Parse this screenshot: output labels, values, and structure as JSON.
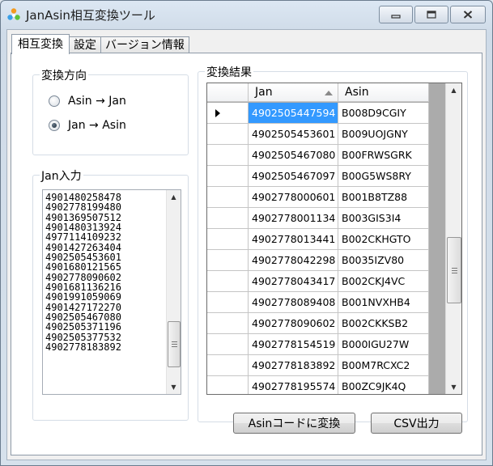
{
  "window": {
    "title": "JanAsin相互変換ツール",
    "icon": "app-recycle-icon"
  },
  "tabs": [
    {
      "label": "相互変換",
      "active": true
    },
    {
      "label": "設定",
      "active": false
    },
    {
      "label": "バージョン情報",
      "active": false
    }
  ],
  "direction": {
    "title": "変換方向",
    "options": [
      {
        "label": "Asin → Jan",
        "selected": false
      },
      {
        "label": "Jan → Asin",
        "selected": true
      }
    ]
  },
  "jan_input": {
    "title": "Jan入力",
    "lines": [
      "4901480258478",
      "4902778199480",
      "4901369507512",
      "4901480313924",
      "4977114109232",
      "4901427263404",
      "4902505453601",
      "4901680121565",
      "4902778090602",
      "4901681136216",
      "4901991059069",
      "4901427172270",
      "4902505467080",
      "4902505371196",
      "4902505377532",
      "4902778183892"
    ]
  },
  "results": {
    "title": "変換結果",
    "columns": [
      "Jan",
      "Asin"
    ],
    "rows": [
      {
        "jan": "4902505447594",
        "asin": "B008D9CGIY"
      },
      {
        "jan": "4902505453601",
        "asin": "B009UOJGNY"
      },
      {
        "jan": "4902505467080",
        "asin": "B00FRWSGRK"
      },
      {
        "jan": "4902505467097",
        "asin": "B00G5WS8RY"
      },
      {
        "jan": "4902778000601",
        "asin": "B001B8TZ88"
      },
      {
        "jan": "4902778001134",
        "asin": "B003GIS3I4"
      },
      {
        "jan": "4902778013441",
        "asin": "B002CKHGTO"
      },
      {
        "jan": "4902778042298",
        "asin": "B0035IZV80"
      },
      {
        "jan": "4902778043417",
        "asin": "B002CKJ4VC"
      },
      {
        "jan": "4902778089408",
        "asin": "B001NVXHB4"
      },
      {
        "jan": "4902778090602",
        "asin": "B002CKKSB2"
      },
      {
        "jan": "4902778154519",
        "asin": "B000IGU27W"
      },
      {
        "jan": "4902778183892",
        "asin": "B00M7RCXC2"
      },
      {
        "jan": "4902778195574",
        "asin": "B00ZC9JK4Q"
      }
    ]
  },
  "buttons": {
    "convert": "Asinコードに変換",
    "csv": "CSV出力"
  },
  "colors": {
    "selection": "#3399ff",
    "window_frame": "#dce7f3"
  }
}
